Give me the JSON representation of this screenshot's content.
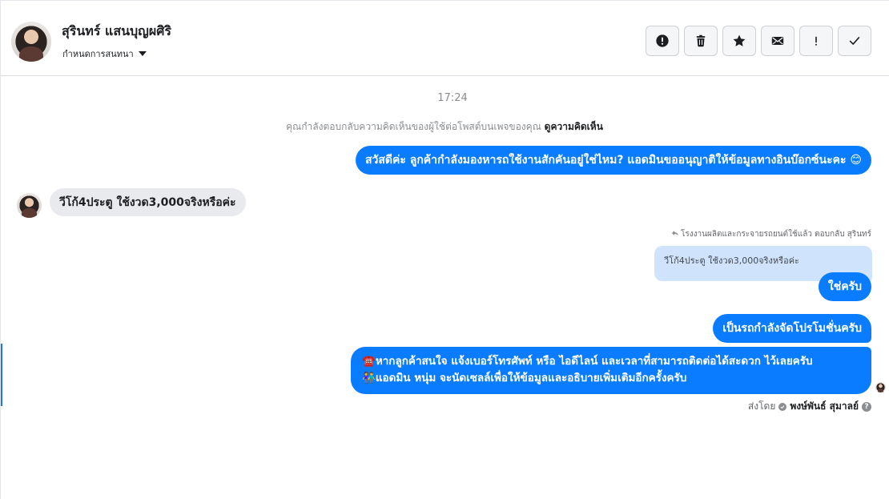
{
  "header": {
    "contact_name": "สุรินทร์ แสนบุญผศิริ",
    "assign_label": "กำหนดการสนทนา",
    "toolbar": [
      {
        "name": "report-button",
        "icon": "alert-circle-icon"
      },
      {
        "name": "delete-button",
        "icon": "trash-icon"
      },
      {
        "name": "star-button",
        "icon": "star-icon"
      },
      {
        "name": "mark-unread-button",
        "icon": "envelope-icon"
      },
      {
        "name": "important-button",
        "icon": "exclamation-icon"
      },
      {
        "name": "done-button",
        "icon": "check-icon"
      }
    ]
  },
  "conversation": {
    "timestamp": "17:24",
    "context_text": "คุณกำลังตอบกลับความคิดเห็นของผู้ใช้ต่อโพสต์บนเพจของคุณ",
    "context_link": "ดูความคิดเห็น",
    "msg1": "สวัสดีค่ะ ลูกค้ากำลังมองหารถใช้งานสักคันอยู่ใช่ไหม? แอดมินขออนุญาติให้ข้อมูลทางอินบ๊อกซ์นะคะ 😊",
    "msg_in": "วีโก้4ประตู ใช้งวด3,000จริงหรือค่ะ",
    "reply_meta": "โรงงานผลิตและกระจายรถยนต์ใช้แล้ว ตอบกลับ สุรินทร์",
    "quoted": "วีโก้4ประตู ใช้งวด3,000จริงหรือค่ะ",
    "msg2": "ใช่ครับ",
    "msg3": "เป็นรถกำลังจัดโปรโมชั่นครับ",
    "msg4_line1_emoji": "☎️",
    "msg4_line1": "หากลูกค้าสนใจ แจ้งเบอร์โทรศัพท์ หรือ ไอดีไลน์ และเวลาที่สามารถติดต่อได้สะดวก ไว้เลยครับ",
    "msg4_line2_emoji": "👫",
    "msg4_line2": "แอดมิน หนุ่ม จะนัดเซลล์เพื่อให้ข้อมูลและอธิบายเพิ่มเติมอีกครั้งครับ",
    "sent_by_label": "ส่งโดย",
    "sent_by_agent": "พงษ์พันธ์ สุมาลย์"
  },
  "colors": {
    "outgoing_bubble": "#0a7cff",
    "incoming_bubble": "#e9eaed",
    "quoted_bubble": "#cfe3fd"
  }
}
